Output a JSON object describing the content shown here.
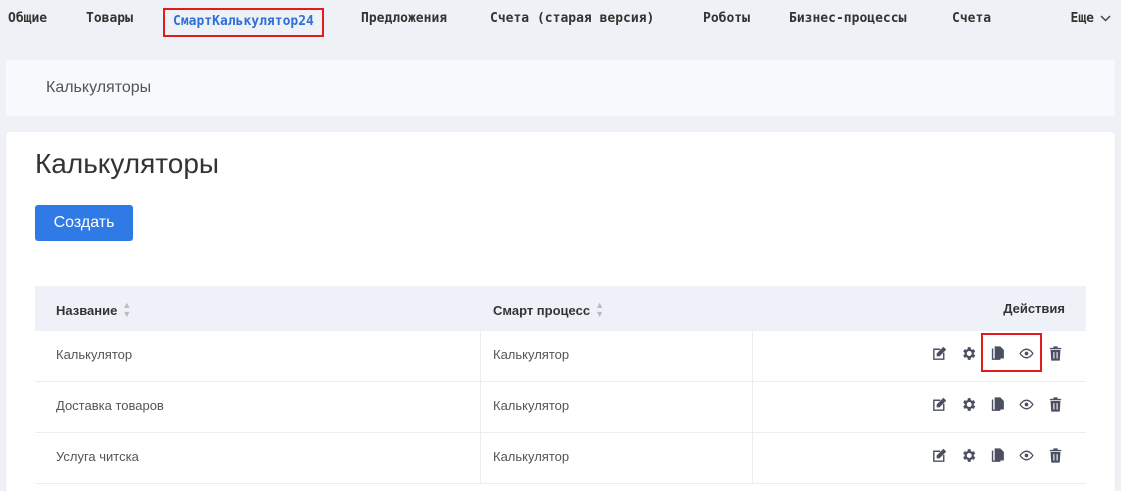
{
  "nav": {
    "items": [
      "Общие",
      "Товары",
      "СмартКалькулятор24",
      "Предложения",
      "Счета (старая версия)",
      "Роботы",
      "Бизнес-процессы",
      "Счета"
    ],
    "active_index": 2,
    "more_label": "Еще"
  },
  "breadcrumb": {
    "label": "Калькуляторы"
  },
  "page": {
    "title": "Калькуляторы",
    "create_label": "Создать"
  },
  "table": {
    "headers": {
      "name": "Название",
      "process": "Смарт процесс",
      "actions": "Действия"
    },
    "rows": [
      {
        "name": "Калькулятор",
        "process": "Калькулятор"
      },
      {
        "name": "Доставка товаров",
        "process": "Калькулятор"
      },
      {
        "name": "Услуга читска",
        "process": "Калькулятор"
      }
    ],
    "action_icons": [
      "edit-icon",
      "gear-icon",
      "copy-icon",
      "eye-icon",
      "trash-icon"
    ]
  },
  "colors": {
    "accent": "#2f7ae5",
    "active_nav": "#2f6fd8",
    "highlight": "#e21b1b"
  }
}
